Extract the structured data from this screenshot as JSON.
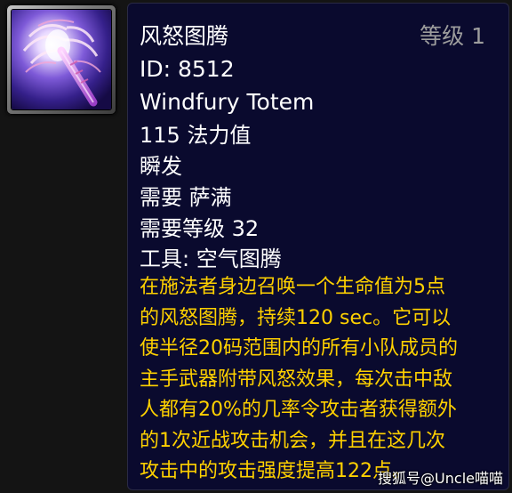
{
  "spell_icon": {
    "icon": "windfury-totem-icon",
    "colors": {
      "frame": "#8a8a8a",
      "background": "#2b1a6e",
      "glow": "#f3e6ff",
      "accent": "#b36ad9"
    }
  },
  "tooltip": {
    "name": "风怒图腾",
    "rank": "等级 1",
    "id_line": "ID: 8512",
    "english_name": "Windfury Totem",
    "mana_cost": "115 法力值",
    "cast_time": "瞬发",
    "requires_class": "需要 萨满",
    "requires_level": "需要等级 32",
    "tools": "工具: 空气图腾",
    "description_lines": [
      "在施法者身边召唤一个生命值为5点",
      "的风怒图腾，持续120 sec。它可以",
      "使半径20码范围内的所有小队成员的",
      "主手武器附带风怒效果，每次击中敌",
      "人都有20%的几率令攻击者获得额外",
      "的1次近战攻击机会，并且在这几次",
      "攻击中的攻击强度提高122点。"
    ],
    "colors": {
      "background": "#0a0a2e",
      "text": "#ffffff",
      "rank_text": "#9d9d9d",
      "description_text": "#ffd100"
    }
  },
  "watermark": "搜狐号@Uncle喵喵"
}
